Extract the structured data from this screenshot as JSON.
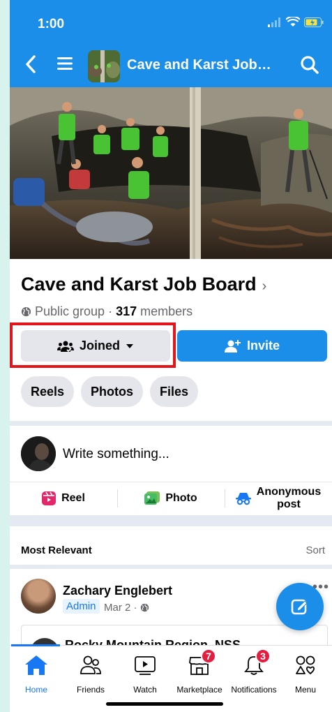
{
  "status_bar": {
    "time": "1:00"
  },
  "header": {
    "title": "Cave and Karst Job…"
  },
  "group": {
    "name": "Cave and Karst Job Board",
    "chevron": "›",
    "privacy": "Public group · ",
    "member_count": "317",
    "members_label": " members"
  },
  "actions": {
    "joined_label": "Joined",
    "invite_label": "Invite"
  },
  "chips": [
    "Reels",
    "Photos",
    "Files"
  ],
  "composer": {
    "placeholder": "Write something..."
  },
  "post_types": {
    "reel": "Reel",
    "photo": "Photo",
    "anonymous_line1": "Anonymous",
    "anonymous_line2": "post"
  },
  "feed": {
    "sort_label": "Most Relevant",
    "sort_button": "Sort"
  },
  "post": {
    "author": "Zachary Englebert",
    "role": "Admin",
    "date": "Mar 2 · ",
    "shared_title": "Rocky Mountain Region, NSS"
  },
  "tabs": [
    {
      "label": "Home"
    },
    {
      "label": "Friends"
    },
    {
      "label": "Watch"
    },
    {
      "label": "Marketplace",
      "badge": "7"
    },
    {
      "label": "Notifications",
      "badge": "3"
    },
    {
      "label": "Menu"
    }
  ],
  "colors": {
    "brand": "#1a8ee9",
    "highlight": "#e4141b",
    "badge": "#e41e3f",
    "background": "#d8f3ee"
  }
}
